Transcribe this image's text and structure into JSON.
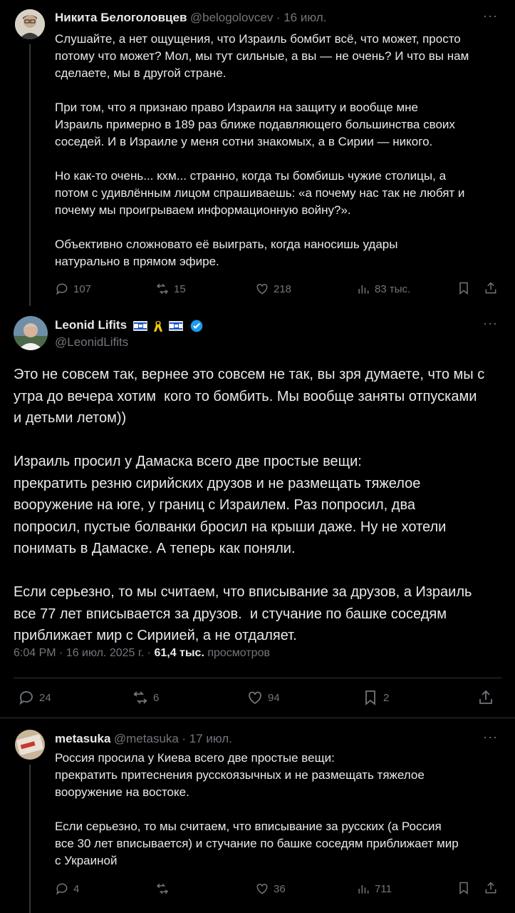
{
  "tweet1": {
    "name": "Никита Белоголовцев",
    "handle": "@belogolovcev",
    "date": "· 16 июл.",
    "more": "···",
    "text": "Слушайте, а нет ощущения, что Израиль бомбит всё, что может, просто\nпотому что может? Мол, мы тут сильные, а вы — не очень? И что вы нам\nсделаете, мы в другой стране.\n\nПри том, что я признаю право Израиля на защиту и вообще мне\nИзраиль примерно в 189 раз ближе подавляющего большинства своих\nсоседей. И в Израиле у меня сотни знакомых, а в Сирии — никого.\n\nНо как-то очень... кхм... странно, когда ты бомбишь чужие столицы, а\nпотом с удивлённым лицом спрашиваешь: «а почему нас так не любят и\nпочему мы проигрываем информационную войну?».\n\nОбъективно сложновато её выиграть, когда наносишь удары\nнатурально в прямом эфире.",
    "replies": "107",
    "reposts": "15",
    "likes": "218",
    "views": "83 тыс."
  },
  "tweet2": {
    "name": "Leonid Lifits",
    "handle": "@LeonidLifits",
    "more": "···",
    "text": "Это не совсем так, вернее это совсем не так, вы зря думаете, что мы с\nутра до вечера хотим  кого то бомбить. Мы вообще заняты отпусками\nи детьми летом))\n\nИзраиль просил у Дамаска всего две простые вещи:\nпрекратить резню сирийских друзов и не размещать тяжелое\nвооружение на юге, у границ с Израилем. Раз попросил, два\nпопросил, пустые болванки бросил на крыши даже. Ну не хотели\nпонимать в Дамаске. А теперь как поняли.\n\nЕсли серьезно, то мы считаем, что вписывание за друзов, а Израиль\nвсе 77 лет вписывается за друзов.  и стучание по башке соседям\nприближает мир с Сириией, а не отдаляет.",
    "timestamp": "6:04 PM · 16 июл. 2025 г. · ",
    "views_count": "61,4 тыс.",
    "views_label": " просмотров",
    "replies": "24",
    "reposts": "6",
    "likes": "94",
    "bookmarks": "2"
  },
  "tweet3": {
    "name": "metasuka",
    "handle": "@metasuka",
    "date": "· 17 июл.",
    "more": "···",
    "text": "Россия просила у Киева всего две простые вещи:\nпрекратить притеснения русскоязычных и не размещать тяжелое\nвооружение на востоке.\n\nЕсли серьезно, то мы считаем, что вписывание за русских (а Россия\nвсе 30 лет вписывается) и стучание по башке соседям приближает мир\nс Украиной",
    "replies": "4",
    "reposts": "",
    "likes": "36",
    "views": "711"
  },
  "colors": {
    "background": "#000000",
    "text": "#e7e9ea",
    "muted": "#71767b",
    "verified": "#1d9bf0",
    "divider": "#2f3336"
  }
}
